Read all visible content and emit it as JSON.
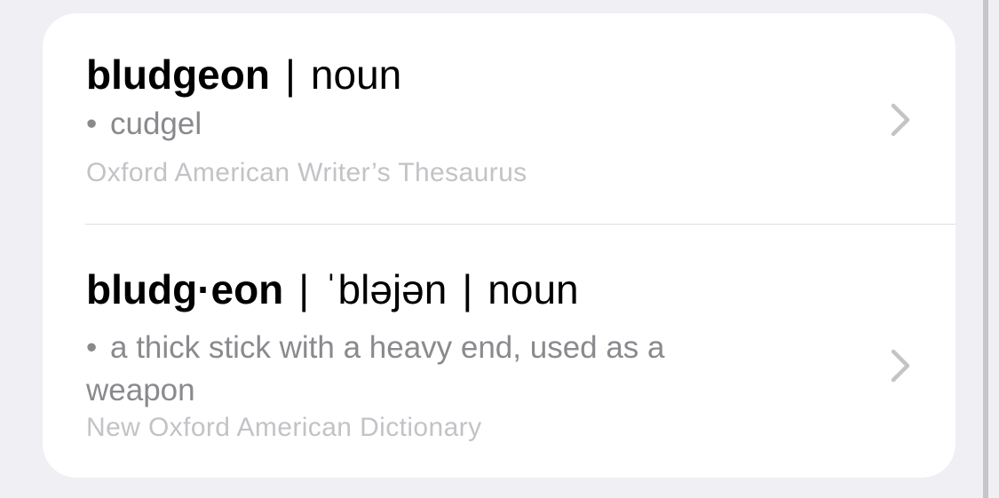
{
  "entries": [
    {
      "headword": "bludgeon",
      "separator": "|",
      "part_of_speech": "noun",
      "bullet": "•",
      "definition": "cudgel",
      "source": "Oxford American Writer’s Thesaurus",
      "chevron_icon": "chevron-right-icon"
    },
    {
      "headword": "bludg·eon",
      "separator": "|",
      "pronunciation": "ˈbləjən",
      "part_of_speech": "noun",
      "bullet": "•",
      "definition": "a thick stick with a heavy end, used as a weapon",
      "source": "New Oxford American Dictionary",
      "chevron_icon": "chevron-right-icon"
    }
  ],
  "colors": {
    "background": "#f0eff4",
    "card": "#ffffff",
    "headword": "#000000",
    "definition": "#8a8a8e",
    "source": "#c3c3c7",
    "chevron": "#c4c4c7",
    "scrollbar": "#c6c6c8"
  }
}
